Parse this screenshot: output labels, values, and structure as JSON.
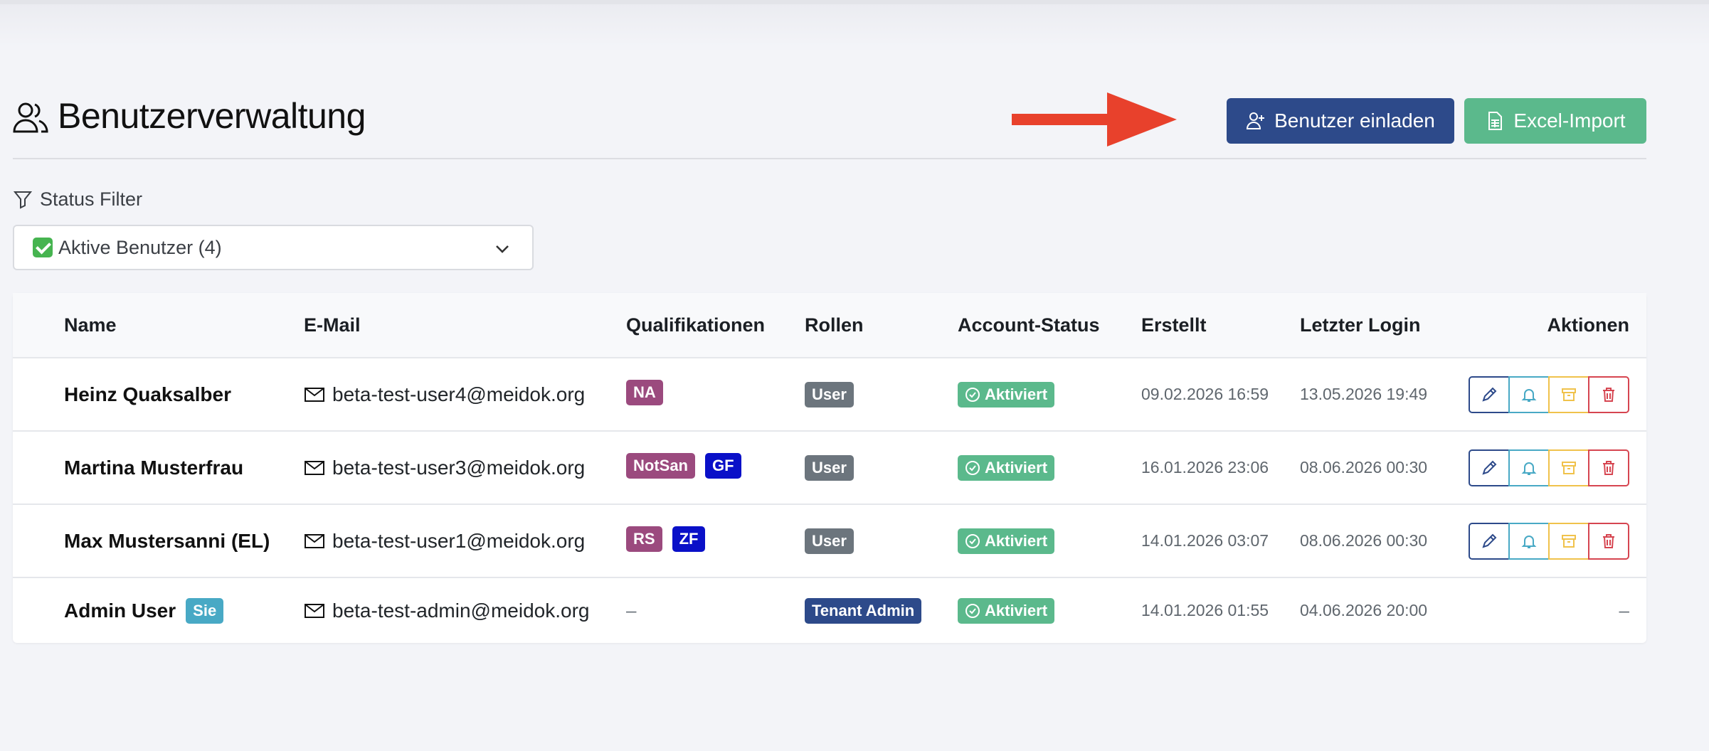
{
  "header": {
    "title": "Benutzerverwaltung",
    "invite_button": "Benutzer einladen",
    "import_button": "Excel-Import"
  },
  "filter": {
    "label": "Status Filter",
    "selected": "Aktive Benutzer (4)"
  },
  "table": {
    "columns": [
      "Name",
      "E-Mail",
      "Qualifikationen",
      "Rollen",
      "Account-Status",
      "Erstellt",
      "Letzter Login",
      "Aktionen"
    ],
    "rows": [
      {
        "name": "Heinz Quaksalber",
        "email": "beta-test-user4@meidok.org",
        "qualifications": [
          {
            "label": "NA",
            "color": "#9b4a7e"
          }
        ],
        "role": "User",
        "status": "Aktiviert",
        "created": "09.02.2026 16:59",
        "last_login": "13.05.2026 19:49",
        "has_actions": true
      },
      {
        "name": "Martina Musterfrau",
        "email": "beta-test-user3@meidok.org",
        "qualifications": [
          {
            "label": "NotSan",
            "color": "#9b4a7e"
          },
          {
            "label": "GF",
            "color": "#0a10c8"
          }
        ],
        "role": "User",
        "status": "Aktiviert",
        "created": "16.01.2026 23:06",
        "last_login": "08.06.2026 00:30",
        "has_actions": true
      },
      {
        "name": "Max Mustersanni (EL)",
        "email": "beta-test-user1@meidok.org",
        "qualifications": [
          {
            "label": "RS",
            "color": "#9b4a7e"
          },
          {
            "label": "ZF",
            "color": "#0a10c8"
          }
        ],
        "role": "User",
        "status": "Aktiviert",
        "created": "14.01.2026 03:07",
        "last_login": "08.06.2026 00:30",
        "has_actions": true
      },
      {
        "name": "Admin User",
        "self_badge": "Sie",
        "email": "beta-test-admin@meidok.org",
        "qualifications_empty": "–",
        "role": "Tenant Admin",
        "status": "Aktiviert",
        "created": "14.01.2026 01:55",
        "last_login": "04.06.2026 20:00",
        "actions_empty": "–"
      }
    ]
  },
  "colors": {
    "primary": "#2d4a8a",
    "success": "#5bb98c",
    "role_user": "#6c757d",
    "qual_purple": "#9b4a7e",
    "qual_blue": "#0a10c8",
    "self_badge": "#48a9c5",
    "annotation_arrow": "#e8412c"
  }
}
